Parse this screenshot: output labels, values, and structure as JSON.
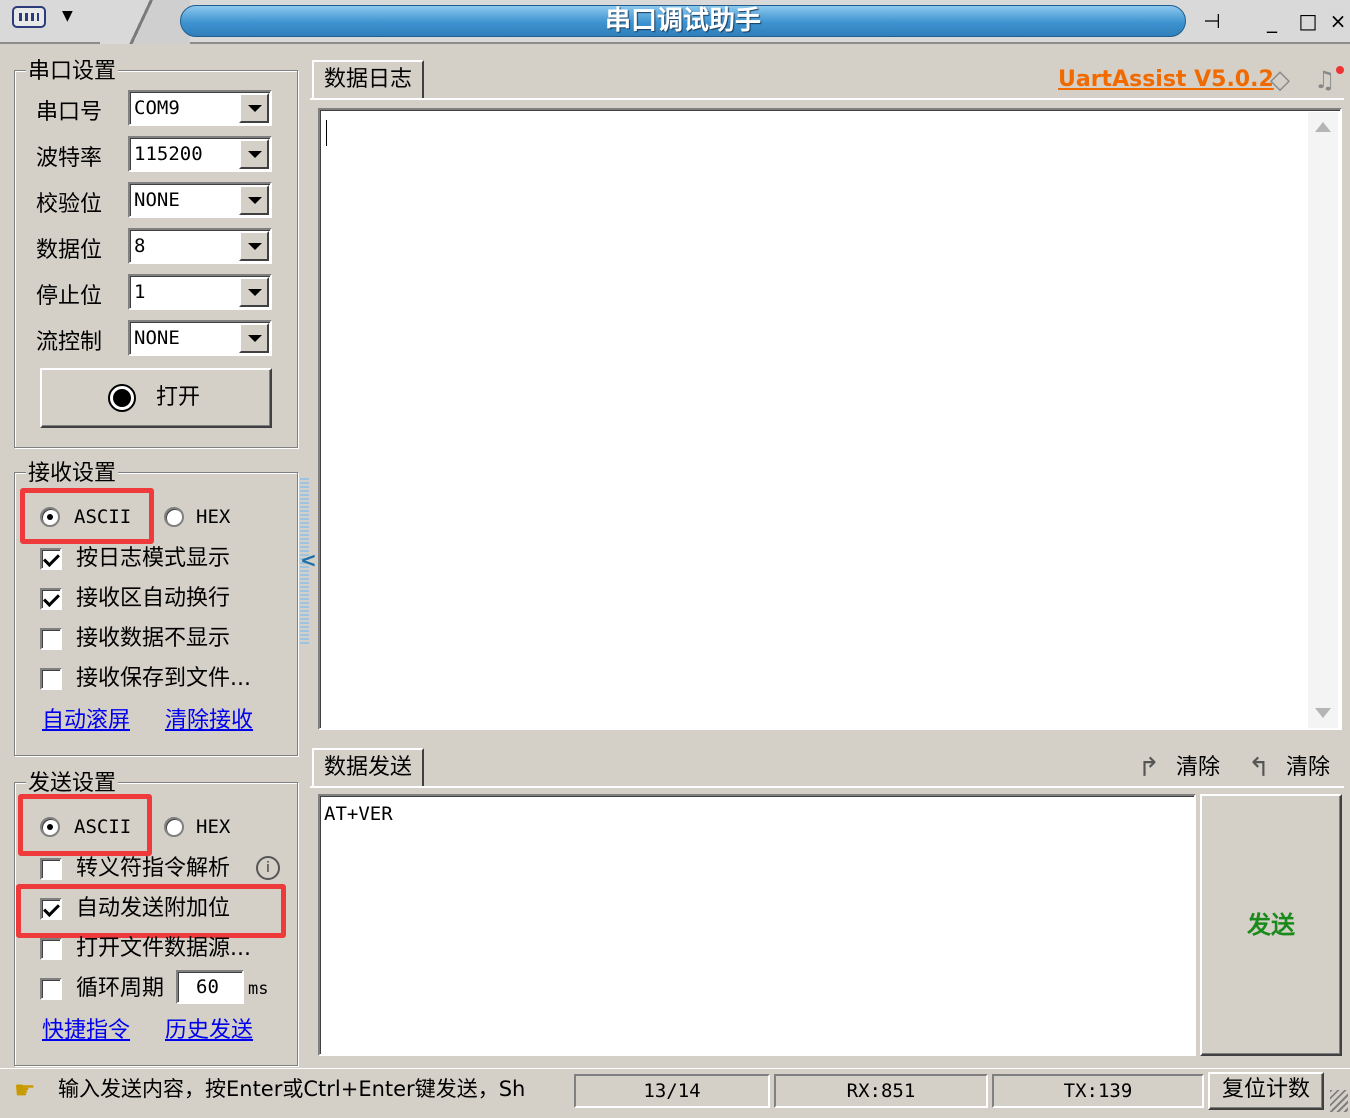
{
  "window": {
    "title": "串口调试助手",
    "pin_glyph": "⊣",
    "min_glyph": "_",
    "max_glyph": "□",
    "close_glyph": "×"
  },
  "serial_settings": {
    "title": "串口设置",
    "fields": [
      {
        "label": "串口号",
        "value": "COM9"
      },
      {
        "label": "波特率",
        "value": "115200"
      },
      {
        "label": "校验位",
        "value": "NONE"
      },
      {
        "label": "数据位",
        "value": "8"
      },
      {
        "label": "停止位",
        "value": "1"
      },
      {
        "label": "流控制",
        "value": "NONE"
      }
    ],
    "open_button": "打开"
  },
  "receive_settings": {
    "title": "接收设置",
    "ascii": "ASCII",
    "hex": "HEX",
    "options": [
      {
        "label": "按日志模式显示",
        "checked": true
      },
      {
        "label": "接收区自动换行",
        "checked": true
      },
      {
        "label": "接收数据不显示",
        "checked": false
      },
      {
        "label": "接收保存到文件...",
        "checked": false
      }
    ],
    "link_autoscroll": "自动滚屏",
    "link_clear": "清除接收"
  },
  "send_settings": {
    "title": "发送设置",
    "ascii": "ASCII",
    "hex": "HEX",
    "options": [
      {
        "label": "转义符指令解析",
        "checked": false
      },
      {
        "label": "自动发送附加位",
        "checked": true
      },
      {
        "label": "打开文件数据源...",
        "checked": false
      },
      {
        "label": "循环周期",
        "checked": false
      }
    ],
    "cycle_value": "60",
    "cycle_unit": "ms",
    "link_shortcut": "快捷指令",
    "link_history": "历史发送"
  },
  "log": {
    "tab": "数据日志",
    "brand": "UartAssist V5.0.2"
  },
  "send": {
    "tab": "数据发送",
    "clear1": "清除",
    "clear2": "清除",
    "content": "AT+VER",
    "send_button": "发送"
  },
  "status": {
    "hint": "输入发送内容，按Enter或Ctrl+Enter键发送，Sh",
    "page": "13/14",
    "rx": "RX:851",
    "tx": "TX:139",
    "reset": "复位计数"
  },
  "colors": {
    "title_blue": "#3d93d0",
    "brand_orange": "#f06a00",
    "send_green": "#1a8a1a",
    "highlight_red": "#ee3a3a",
    "link_blue": "#0000ee"
  }
}
